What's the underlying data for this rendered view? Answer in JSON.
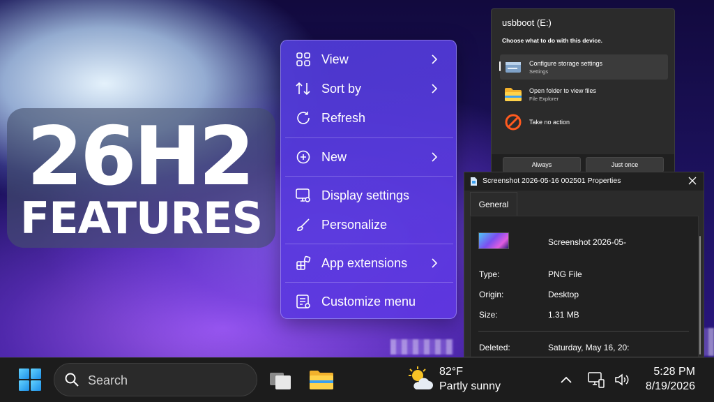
{
  "title": {
    "line1": "26H2",
    "line2": "FEATURES"
  },
  "context_menu": {
    "items": [
      {
        "label": "View",
        "icon": "grid-view-icon",
        "submenu": true
      },
      {
        "label": "Sort by",
        "icon": "sort-arrows-icon",
        "submenu": true
      },
      {
        "label": "Refresh",
        "icon": "refresh-icon",
        "submenu": false
      },
      {
        "label": "New",
        "icon": "plus-circle-icon",
        "submenu": true
      },
      {
        "label": "Display settings",
        "icon": "display-settings-icon",
        "submenu": false
      },
      {
        "label": "Personalize",
        "icon": "brush-icon",
        "submenu": false
      },
      {
        "label": "App extensions",
        "icon": "app-extensions-icon",
        "submenu": true
      },
      {
        "label": "Customize menu",
        "icon": "customize-menu-icon",
        "submenu": false
      }
    ]
  },
  "autoplay": {
    "title": "usbboot (E:)",
    "subtitle": "Choose what to do with this device.",
    "options": [
      {
        "title": "Configure storage settings",
        "subtitle": "Settings",
        "icon": "storage-settings-icon"
      },
      {
        "title": "Open folder to view files",
        "subtitle": "File Explorer",
        "icon": "folder-icon"
      },
      {
        "title": "Take no action",
        "subtitle": "",
        "icon": "no-action-icon"
      }
    ],
    "buttons": {
      "always": "Always",
      "just_once": "Just once"
    }
  },
  "properties": {
    "window_title": "Screenshot 2026-05-16 002501 Properties",
    "tab": "General",
    "file_name": "Screenshot 2026-05-",
    "rows": [
      {
        "label": "Type:",
        "value": "PNG File"
      },
      {
        "label": "Origin:",
        "value": "Desktop"
      },
      {
        "label": "Size:",
        "value": "1.31 MB"
      },
      {
        "label": "Deleted:",
        "value": "Saturday, May 16, 20:"
      }
    ]
  },
  "taskbar": {
    "search_placeholder": "Search",
    "weather": {
      "temp": "82°F",
      "desc": "Partly sunny"
    },
    "clock": {
      "time": "5:28 PM",
      "date": "8/19/2026"
    }
  },
  "colors": {
    "menu_bg": "#5a3ee0",
    "dialog_bg": "#2b2b2b",
    "taskbar_bg": "#1c1c1c",
    "accent_blue": "#3aa0f0"
  }
}
